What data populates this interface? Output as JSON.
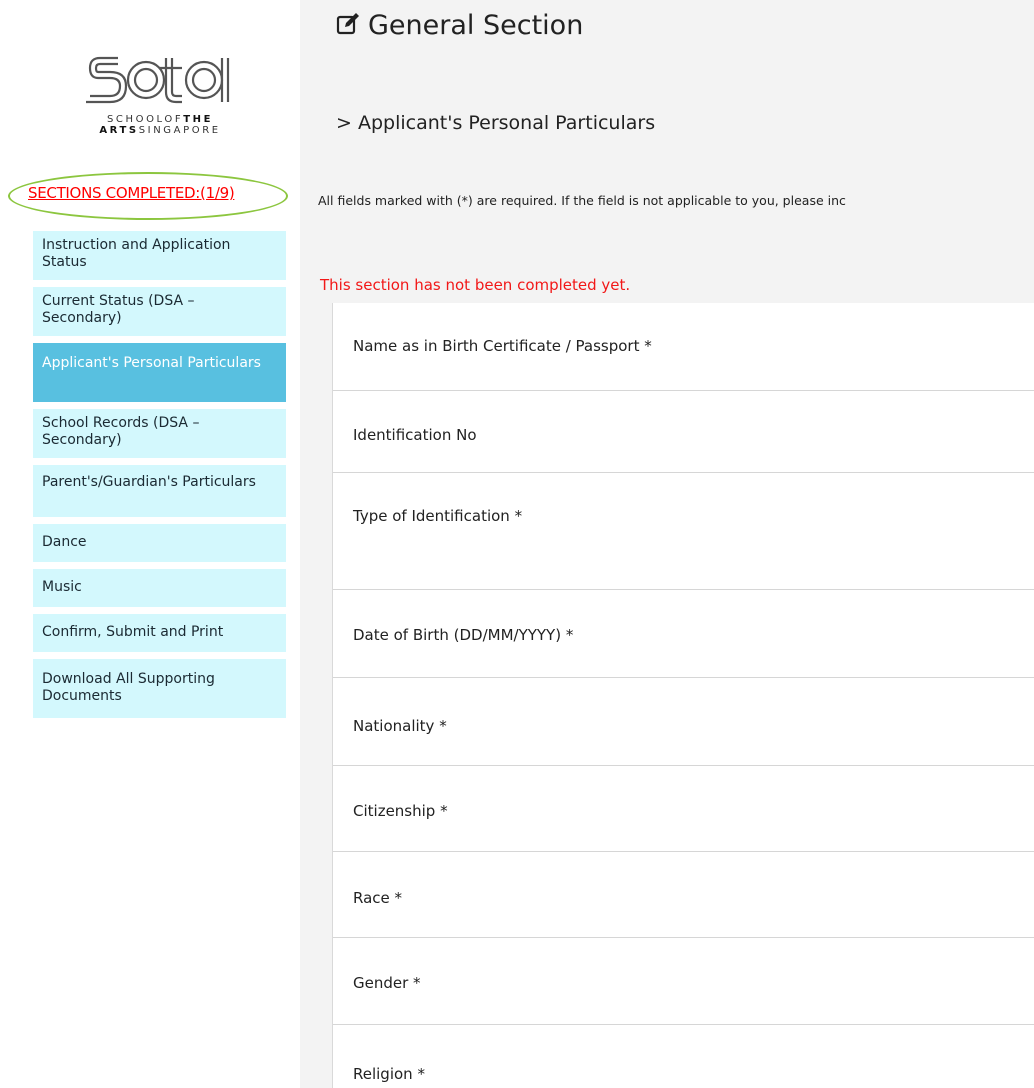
{
  "logo": {
    "wordmark": "sota",
    "line1_light": "SCHOOLOF",
    "line1_bold": "THE",
    "line2_bold": "ARTS",
    "line2_light": "SINGAPORE"
  },
  "sidebar": {
    "sections_completed": "SECTIONS COMPLETED:(1/9)",
    "items": [
      {
        "label": "Instruction and Application Status",
        "active": false
      },
      {
        "label": "Current Status (DSA – Secondary)",
        "active": false
      },
      {
        "label": "Applicant's Personal Particulars",
        "active": true
      },
      {
        "label": "School Records (DSA – Secondary)",
        "active": false
      },
      {
        "label": "Parent's/Guardian's Particulars",
        "active": false
      },
      {
        "label": "Dance",
        "active": false
      },
      {
        "label": "Music",
        "active": false
      },
      {
        "label": "Confirm, Submit and Print",
        "active": false
      },
      {
        "label": "Download All Supporting Documents",
        "active": false
      }
    ]
  },
  "main": {
    "title": "General Section",
    "subtitle": "> Applicant's Personal Particulars",
    "note": "All fields marked with (*) are required. If the field is not applicable to you, please inc",
    "warning": "This section has not been completed yet.",
    "fields": [
      "Name as in Birth Certificate / Passport *",
      "Identification No",
      "Type of Identification *",
      "Date of Birth (DD/MM/YYYY) *",
      "Nationality *",
      "Citizenship *",
      "Race *",
      "Gender *",
      "Religion *"
    ]
  },
  "colors": {
    "nav_bg": "#d3f8fd",
    "nav_active_bg": "#58c0e0",
    "warning": "#f21818",
    "highlight_oval": "#8cc63f",
    "main_bg": "#f3f3f3"
  }
}
